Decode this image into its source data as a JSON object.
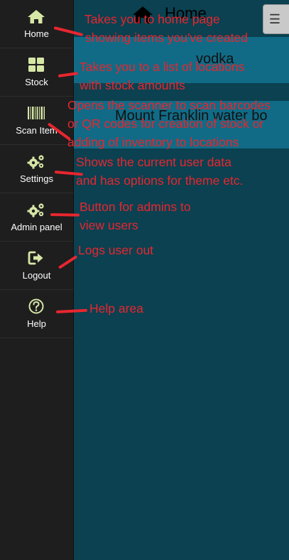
{
  "background": {
    "page_title": "Home",
    "menu_icon": "☰",
    "items": [
      "vodka",
      "Mount Franklin water bo"
    ]
  },
  "sidebar": {
    "items": [
      {
        "label": "Home",
        "icon": "home-icon"
      },
      {
        "label": "Stock",
        "icon": "grid-icon"
      },
      {
        "label": "Scan Item",
        "icon": "barcode-icon"
      },
      {
        "label": "Settings",
        "icon": "gears-icon"
      },
      {
        "label": "Admin panel",
        "icon": "gears-icon"
      },
      {
        "label": "Logout",
        "icon": "sign-out-icon"
      },
      {
        "label": "Help",
        "icon": "question-circle-icon"
      }
    ]
  },
  "annotations": {
    "home": [
      "Takes you to home page",
      "showing items you've created"
    ],
    "stock": [
      "Takes you to a list of locations",
      "with stock amounts"
    ],
    "scan": [
      "Opens the scanner to scan barcodes",
      "or QR codes for creation of stock or",
      "adding of inventory to locations"
    ],
    "settings": [
      "Shows the current user data",
      "and has options for theme etc."
    ],
    "admin": [
      "Button for admins to",
      "view users"
    ],
    "logout": [
      "Logs user out"
    ],
    "help": [
      "Help area"
    ]
  },
  "colors": {
    "sidebar_bg": "#1e1e1e",
    "icon_color": "#d6e6a6",
    "annotation_red": "#e8262f",
    "app_bg": "#0b4150",
    "row_bg": "#116b86"
  }
}
